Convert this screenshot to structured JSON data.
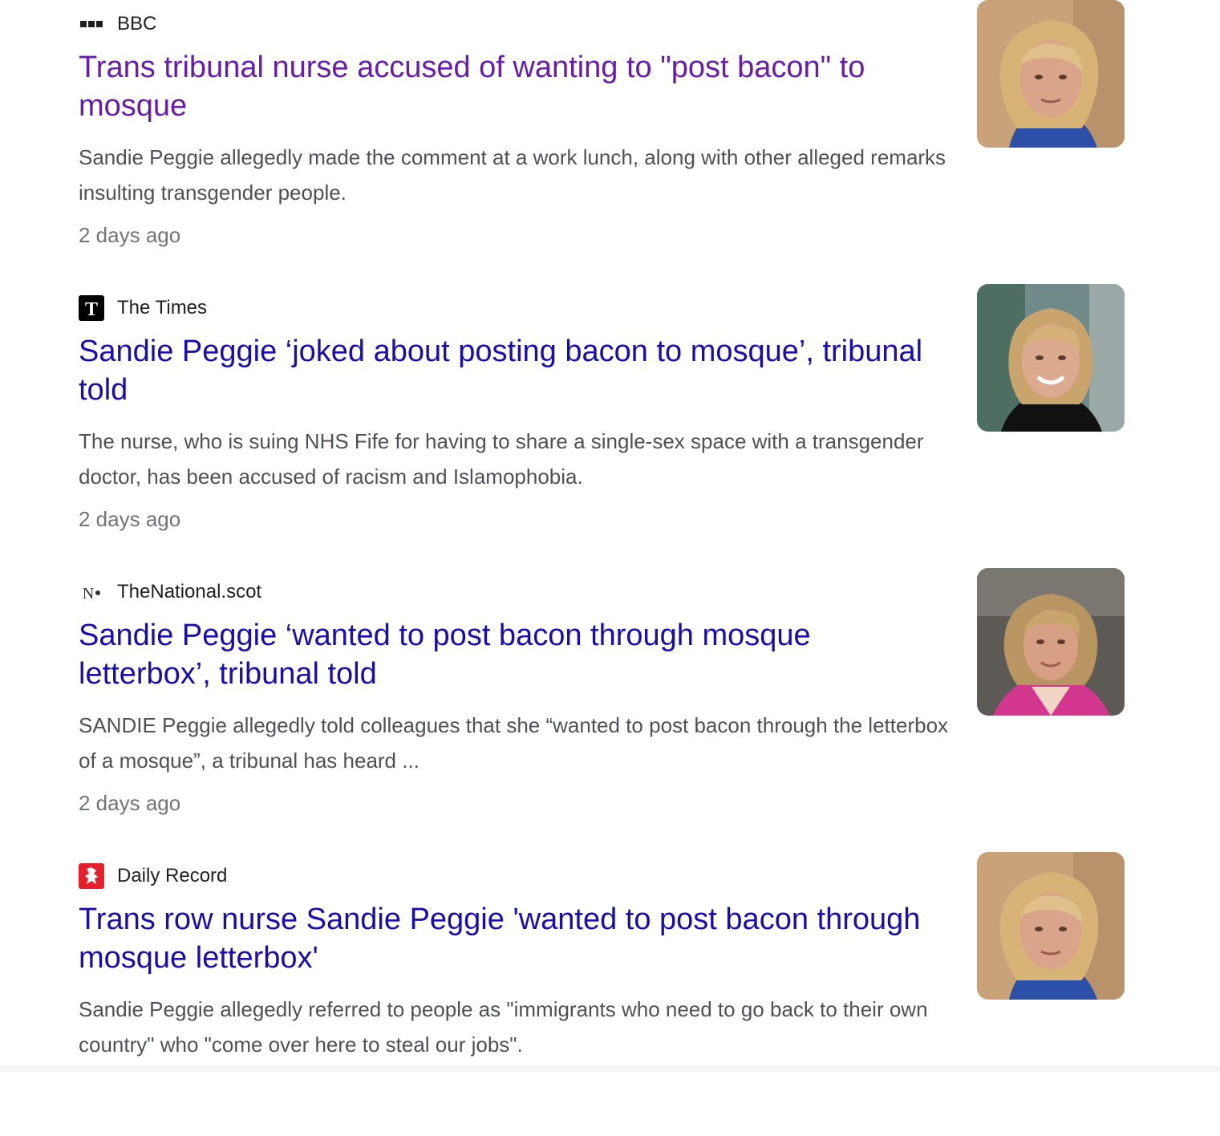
{
  "results": [
    {
      "source": "BBC",
      "favicon": "bbc-logo-icon",
      "headline": "Trans tribunal nurse accused of wanting to \"post bacon\" to mosque",
      "headline_color": "#681da8",
      "snippet": "Sandie Peggie allegedly made the comment at a work lunch, along with other alleged remarks insulting transgender people.",
      "date": "2 days ago",
      "thumbnail": "woman-portrait-thumbnail"
    },
    {
      "source": "The Times",
      "favicon": "times-t-icon",
      "headline": "Sandie Peggie ‘joked about posting bacon to mosque’, tribunal told",
      "headline_color": "#1a0dab",
      "snippet": "The nurse, who is suing NHS Fife for having to share a single-sex space with a transgender doctor, has been accused of racism and Islamophobia.",
      "date": "2 days ago",
      "thumbnail": "woman-portrait-thumbnail"
    },
    {
      "source": "TheNational.scot",
      "favicon": "the-national-icon",
      "favicon_text": "N",
      "headline": "Sandie Peggie ‘wanted to post bacon through mosque letterbox’, tribunal told",
      "headline_color": "#1a0dab",
      "snippet": "SANDIE Peggie allegedly told colleagues that she “wanted to post bacon through the letterbox of a mosque”, a tribunal has heard ...",
      "date": "2 days ago",
      "thumbnail": "woman-portrait-thumbnail"
    },
    {
      "source": "Daily Record",
      "favicon": "daily-record-lion-icon",
      "headline": "Trans row nurse Sandie Peggie 'wanted to post bacon through mosque letterbox'",
      "headline_color": "#1a0dab",
      "snippet": "Sandie Peggie allegedly referred to people as \"immigrants who need to go back to their own country\" who \"come over here to steal our jobs\".",
      "date": "",
      "thumbnail": "woman-portrait-thumbnail"
    }
  ],
  "times_favicon": {
    "letter": "T"
  },
  "colors": {
    "link": "#1a0dab",
    "visited": "#681da8",
    "snippet": "#4d5156",
    "date": "#70757a",
    "daily_record_red": "#e4202d"
  }
}
